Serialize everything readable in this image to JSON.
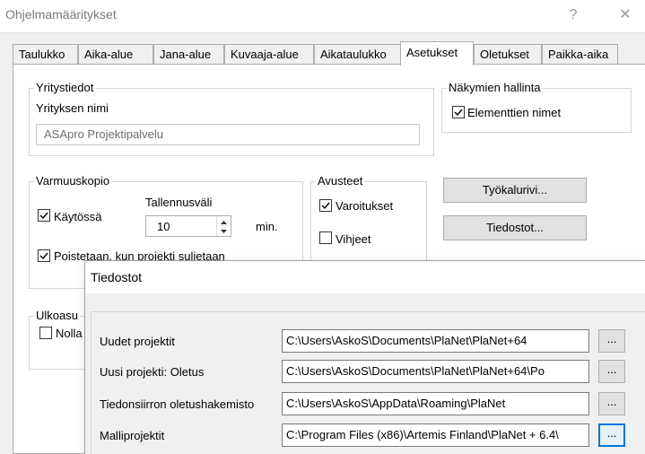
{
  "window": {
    "title": "Ohjelmamääritykset",
    "help_label": "?",
    "close_label": "✕"
  },
  "tabs": [
    {
      "label": "Taulukko"
    },
    {
      "label": "Aika-alue"
    },
    {
      "label": "Jana-alue"
    },
    {
      "label": "Kuvaaja-alue"
    },
    {
      "label": "Aikataulukko"
    },
    {
      "label": "Asetukset",
      "active": true
    },
    {
      "label": "Oletukset"
    },
    {
      "label": "Paikka-aika"
    }
  ],
  "company": {
    "group_label": "Yritystiedot",
    "name_label": "Yrityksen nimi",
    "name_value": "ASApro Projektipalvelu"
  },
  "views": {
    "group_label": "Näkymien hallinta",
    "element_names_label": "Elementtien nimet",
    "element_names_checked": true
  },
  "backup": {
    "group_label": "Varmuuskopio",
    "interval_label": "Tallennusväli",
    "in_use_label": "Käytössä",
    "in_use_checked": true,
    "interval_value": "10",
    "unit_label": "min.",
    "delete_label": "Poistetaan, kun projekti suljetaan",
    "delete_checked": true
  },
  "helpers": {
    "group_label": "Avusteet",
    "warnings_label": "Varoitukset",
    "warnings_checked": true,
    "hints_label": "Vihjeet",
    "hints_checked": false
  },
  "buttons": {
    "toolbar": "Työkalurivi...",
    "files": "Tiedostot..."
  },
  "appearance": {
    "group_label": "Ulkoasu",
    "zero_label": "Nolla"
  },
  "files_dialog": {
    "title": "Tiedostot",
    "rows": [
      {
        "label": "Uudet projektit",
        "value": "C:\\Users\\AskoS\\Documents\\PlaNet\\PlaNet+64",
        "browse": "..."
      },
      {
        "label": "Uusi projekti: Oletus",
        "value": "C:\\Users\\AskoS\\Documents\\PlaNet\\PlaNet+64\\Po",
        "browse": "..."
      },
      {
        "label": "Tiedonsiirron oletushakemisto",
        "value": "C:\\Users\\AskoS\\AppData\\Roaming\\PlaNet",
        "browse": "..."
      },
      {
        "label": "Malliprojektit",
        "value": "C:\\Program Files (x86)\\Artemis Finland\\PlaNet + 6.4\\",
        "browse": "..."
      }
    ]
  }
}
